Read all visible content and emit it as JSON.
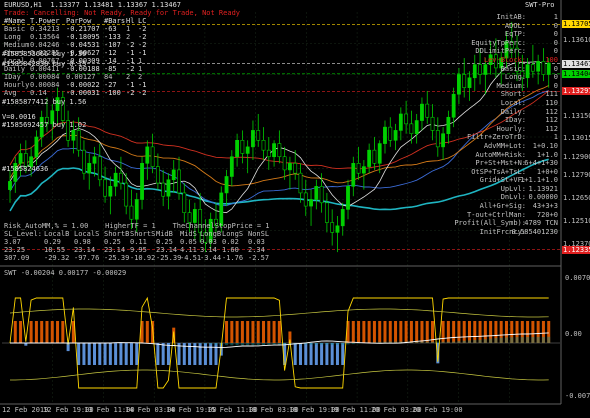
{
  "header": {
    "symbol_line": "EURUSD,H1  1.13377 1.13481 1.13367 1.13467",
    "state_line": "Trade: Cancelling: Not Ready, Ready for Trade, Not Ready",
    "indicator_name": "SWT-Pro"
  },
  "colors": {
    "background": "#000000",
    "bull_candle": "#00d000",
    "bear_candle": "#00d000",
    "ma_teal": "#1fb5c2",
    "ma_blue": "#3b6bd6",
    "ma_red": "#d03020",
    "ma_orange": "#d47a18",
    "ma_white": "#e0e0e0",
    "axis_text": "#c0c0c0",
    "yellow_level": "#ffd700",
    "green_label": "#00d000",
    "red_label": "#e02020"
  },
  "left_table": {
    "header": [
      "#Name",
      "T.Power",
      "ParPow",
      "#Bars",
      "Hl",
      "LC"
    ],
    "rows": [
      [
        "Basic",
        "0.34213",
        "-0.21707",
        "-63",
        "1",
        "-2"
      ],
      [
        "Long",
        "0.13564",
        "-0.18095",
        "-133",
        "2",
        "-2"
      ],
      [
        "Medium",
        "0.04246",
        "-0.04531",
        "-107",
        "-2",
        "-2"
      ],
      [
        "Short",
        "0.01285",
        "-0.00627",
        "-12",
        "-1",
        "-1"
      ],
      [
        "Local",
        "0.00767",
        "-0.00309",
        "-14",
        "-1",
        "1"
      ],
      [
        "Daily",
        "0.00411",
        "-0.00188",
        "-85",
        "-2",
        "1"
      ],
      [
        "IDay",
        "0.00084",
        "0.00127",
        "84",
        "2",
        "2"
      ],
      [
        "Hourly",
        "0.00084",
        "-0.00022",
        "-27",
        "-1",
        "-1"
      ],
      [
        "Avg",
        "0.14",
        "-0.00031",
        "-100",
        "-2",
        "-2"
      ]
    ],
    "overlay_labels": [
      "#1585853666 buy 1.30",
      "#1585842838 buy 0.15",
      "#1585877412 buy 1.56",
      "V=0.0016",
      "#1585692457 buy 1.02",
      "#1585824636"
    ]
  },
  "bottom_table": {
    "line1": "Risk_AutoMM,% = 1.00    HigherTF = 1    TheChannelStopPrice = 1",
    "header": [
      "SL_Level:",
      "LocalB",
      "LocalS",
      "ShortB",
      "ShortS",
      "MidB",
      "MidS",
      "LongB",
      "LongS",
      "NonSL"
    ],
    "rows": [
      [
        "3.07",
        "0.29",
        "0.98",
        "0.25",
        "0.11",
        "0.25",
        "0.05",
        "0.03",
        "0.02",
        "0.03"
      ],
      [
        "23.25",
        "18.55",
        "23.14",
        "23.14",
        "9.95",
        "23.14",
        "4.11",
        "3.14",
        "1.60",
        "2.34"
      ],
      [
        "307.09",
        "-29.32",
        "-97.76",
        "-25.39",
        "-10.92",
        "-25.39",
        "-4.51",
        "-3.44",
        "-1.76",
        "-2.57"
      ]
    ]
  },
  "right_panel": [
    [
      "InitAB:",
      "1"
    ],
    [
      "ADOL:",
      "0"
    ],
    [
      "EqTP:",
      "0"
    ],
    [
      "EquityTpPerc:",
      "0"
    ],
    [
      "DDLimitPerc:",
      "0"
    ],
    [
      "Lev-Block:",
      "100"
    ],
    [
      "Basic:",
      "0"
    ],
    [
      "Long:",
      "0"
    ],
    [
      "Medium:",
      "0"
    ],
    [
      "Short:",
      "111"
    ],
    [
      "Local:",
      "110"
    ],
    [
      "Daily:",
      "112"
    ],
    [
      "IDay:",
      "112"
    ],
    [
      "Hourly:",
      "112"
    ],
    [
      "Filtr+ZeroTrD:",
      "1"
    ],
    [
      "AdvMM+Lot:",
      "1+0.10"
    ],
    [
      "AutoMM+Risk:",
      "1+1.0"
    ],
    [
      "Pr+St+Mst+N:",
      "6+4+1+30"
    ],
    [
      "OtSP+TsA+TsL:",
      "1+0+0"
    ],
    [
      "Grid+St+VF:",
      "1+1.1+1.0"
    ],
    [
      "UpLvl:",
      "1.13921"
    ],
    [
      "DnLvl:",
      "0.00000"
    ],
    [
      "All+Gr+Sig:",
      "43+3+3"
    ],
    [
      "T-out+CtrlMan:",
      "720+0"
    ],
    [
      "Profit(All_Symb):",
      "4789 TCN"
    ],
    [
      "InitFrcncy:",
      "0.585401230"
    ]
  ],
  "price_axis": {
    "labels": [
      "1.13705",
      "1.13610",
      "1.13467",
      "1.13404",
      "1.13297",
      "1.13150",
      "1.13015",
      "1.12900",
      "1.12790",
      "1.12650",
      "1.12510",
      "1.12370",
      "1.12335"
    ],
    "highlight_top": "1.13705",
    "highlight_current": "1.13467",
    "highlight_green": "1.13404",
    "highlight_red_mid": "1.13297",
    "highlight_red_bottom": "1.12335"
  },
  "oscillator": {
    "header": "SWT -0.00204 0.00177 -0.00029",
    "axis_labels": [
      "0.00702",
      "0.00",
      "-0.00719"
    ]
  },
  "time_axis": {
    "labels": [
      "12 Feb 2019",
      "12 Feb 19:00",
      "13 Feb 11:00",
      "14 Feb 03:00",
      "14 Feb 19:00",
      "15 Feb 11:00",
      "18 Feb 03:00",
      "18 Feb 19:00",
      "19 Feb 11:00",
      "20 Feb 03:00",
      "20 Feb 19:00"
    ]
  },
  "chart_data": {
    "type": "candlestick",
    "symbol": "EURUSD",
    "timeframe": "H1",
    "ylim": [
      1.1226,
      1.1378
    ],
    "candles": [
      [
        1.127,
        1.1282,
        1.1262,
        1.1275
      ],
      [
        1.1275,
        1.129,
        1.1268,
        1.1286
      ],
      [
        1.1286,
        1.1298,
        1.1278,
        1.1292
      ],
      [
        1.1292,
        1.13,
        1.128,
        1.1284
      ],
      [
        1.1284,
        1.1296,
        1.1278,
        1.129
      ],
      [
        1.129,
        1.1306,
        1.1285,
        1.1302
      ],
      [
        1.1302,
        1.1318,
        1.1296,
        1.1314
      ],
      [
        1.1314,
        1.1326,
        1.1305,
        1.131
      ],
      [
        1.131,
        1.1322,
        1.13,
        1.1318
      ],
      [
        1.1318,
        1.1332,
        1.131,
        1.1326
      ],
      [
        1.1326,
        1.133,
        1.1308,
        1.1312
      ],
      [
        1.1312,
        1.1318,
        1.1296,
        1.13
      ],
      [
        1.13,
        1.1312,
        1.1292,
        1.1306
      ],
      [
        1.1306,
        1.1314,
        1.129,
        1.1294
      ],
      [
        1.1294,
        1.13,
        1.1276,
        1.128
      ],
      [
        1.128,
        1.1292,
        1.127,
        1.1286
      ],
      [
        1.1286,
        1.1296,
        1.1278,
        1.129
      ],
      [
        1.129,
        1.1298,
        1.1272,
        1.1276
      ],
      [
        1.1276,
        1.1284,
        1.1262,
        1.1266
      ],
      [
        1.1266,
        1.1278,
        1.1255,
        1.1272
      ],
      [
        1.1272,
        1.1284,
        1.1266,
        1.128
      ],
      [
        1.128,
        1.129,
        1.127,
        1.1274
      ],
      [
        1.1274,
        1.128,
        1.1255,
        1.126
      ],
      [
        1.126,
        1.127,
        1.1246,
        1.1252
      ],
      [
        1.1252,
        1.1268,
        1.1244,
        1.1264
      ],
      [
        1.1264,
        1.129,
        1.1258,
        1.1286
      ],
      [
        1.1286,
        1.13,
        1.1276,
        1.1296
      ],
      [
        1.1296,
        1.1304,
        1.128,
        1.1284
      ],
      [
        1.1284,
        1.1292,
        1.127,
        1.1274
      ],
      [
        1.1274,
        1.1282,
        1.126,
        1.1266
      ],
      [
        1.1266,
        1.128,
        1.1258,
        1.1276
      ],
      [
        1.1276,
        1.1288,
        1.1268,
        1.1282
      ],
      [
        1.1282,
        1.129,
        1.1264,
        1.1268
      ],
      [
        1.1268,
        1.1274,
        1.125,
        1.1256
      ],
      [
        1.1256,
        1.1264,
        1.1244,
        1.125
      ],
      [
        1.125,
        1.1262,
        1.124,
        1.1258
      ],
      [
        1.1258,
        1.1268,
        1.1238,
        1.1244
      ],
      [
        1.1244,
        1.1252,
        1.1232,
        1.1238
      ],
      [
        1.1238,
        1.1256,
        1.1234,
        1.1252
      ],
      [
        1.1252,
        1.1262,
        1.1244,
        1.1248
      ],
      [
        1.1248,
        1.1272,
        1.1244,
        1.1268
      ],
      [
        1.1268,
        1.1282,
        1.126,
        1.1278
      ],
      [
        1.1278,
        1.1294,
        1.1272,
        1.129
      ],
      [
        1.129,
        1.1304,
        1.1284,
        1.13
      ],
      [
        1.13,
        1.1306,
        1.1286,
        1.1292
      ],
      [
        1.1292,
        1.13,
        1.128,
        1.1296
      ],
      [
        1.1296,
        1.1312,
        1.1288,
        1.1306
      ],
      [
        1.1306,
        1.1316,
        1.1296,
        1.13
      ],
      [
        1.13,
        1.1308,
        1.1288,
        1.1294
      ],
      [
        1.1294,
        1.1302,
        1.1282,
        1.129
      ],
      [
        1.129,
        1.13,
        1.1284,
        1.1298
      ],
      [
        1.1298,
        1.1306,
        1.1286,
        1.129
      ],
      [
        1.129,
        1.1296,
        1.1276,
        1.1282
      ],
      [
        1.1282,
        1.129,
        1.127,
        1.1286
      ],
      [
        1.1286,
        1.1294,
        1.1276,
        1.128
      ],
      [
        1.128,
        1.1286,
        1.1262,
        1.1268
      ],
      [
        1.1268,
        1.1276,
        1.1254,
        1.126
      ],
      [
        1.126,
        1.127,
        1.1248,
        1.1264
      ],
      [
        1.1264,
        1.1276,
        1.1258,
        1.1272
      ],
      [
        1.1272,
        1.128,
        1.1256,
        1.1262
      ],
      [
        1.1262,
        1.1268,
        1.1244,
        1.125
      ],
      [
        1.125,
        1.1258,
        1.1236,
        1.1244
      ],
      [
        1.1244,
        1.1254,
        1.1232,
        1.1248
      ],
      [
        1.1248,
        1.1262,
        1.1242,
        1.1258
      ],
      [
        1.1258,
        1.1276,
        1.1252,
        1.1272
      ],
      [
        1.1272,
        1.129,
        1.1266,
        1.1286
      ],
      [
        1.1286,
        1.1296,
        1.1276,
        1.128
      ],
      [
        1.128,
        1.1288,
        1.127,
        1.1284
      ],
      [
        1.1284,
        1.1298,
        1.128,
        1.1294
      ],
      [
        1.1294,
        1.1302,
        1.1282,
        1.1286
      ],
      [
        1.1286,
        1.13,
        1.128,
        1.1298
      ],
      [
        1.1298,
        1.1312,
        1.1292,
        1.1308
      ],
      [
        1.1308,
        1.1314,
        1.1296,
        1.13
      ],
      [
        1.13,
        1.131,
        1.1294,
        1.1306
      ],
      [
        1.1306,
        1.132,
        1.13,
        1.1316
      ],
      [
        1.1316,
        1.1324,
        1.1304,
        1.131
      ],
      [
        1.131,
        1.1318,
        1.1298,
        1.1304
      ],
      [
        1.1304,
        1.1316,
        1.1298,
        1.1312
      ],
      [
        1.1312,
        1.1326,
        1.1306,
        1.1322
      ],
      [
        1.1322,
        1.133,
        1.131,
        1.1314
      ],
      [
        1.1314,
        1.1322,
        1.13,
        1.1306
      ],
      [
        1.1306,
        1.1314,
        1.129,
        1.1296
      ],
      [
        1.1296,
        1.1308,
        1.1288,
        1.1304
      ],
      [
        1.1304,
        1.1318,
        1.1298,
        1.1314
      ],
      [
        1.1314,
        1.1332,
        1.1308,
        1.1328
      ],
      [
        1.1328,
        1.1344,
        1.1322,
        1.134
      ],
      [
        1.134,
        1.135,
        1.1326,
        1.1332
      ],
      [
        1.1332,
        1.1342,
        1.1324,
        1.1338
      ],
      [
        1.1338,
        1.1352,
        1.133,
        1.1346
      ],
      [
        1.1346,
        1.1356,
        1.1334,
        1.134
      ],
      [
        1.134,
        1.135,
        1.1328,
        1.1346
      ],
      [
        1.1346,
        1.136,
        1.134,
        1.1352
      ],
      [
        1.1352,
        1.1362,
        1.1338,
        1.1344
      ],
      [
        1.1344,
        1.1354,
        1.1334,
        1.135
      ],
      [
        1.135,
        1.1366,
        1.1344,
        1.136
      ],
      [
        1.136,
        1.1372,
        1.135,
        1.1356
      ],
      [
        1.1356,
        1.1364,
        1.1336,
        1.1342
      ],
      [
        1.1342,
        1.1352,
        1.133,
        1.1338
      ],
      [
        1.1338,
        1.135,
        1.1332,
        1.1346
      ],
      [
        1.1346,
        1.1358,
        1.1338,
        1.1342
      ],
      [
        1.1342,
        1.1352,
        1.1334,
        1.1348
      ],
      [
        1.1348,
        1.1356,
        1.1336,
        1.134
      ],
      [
        1.134,
        1.135,
        1.1332,
        1.1347
      ]
    ]
  }
}
